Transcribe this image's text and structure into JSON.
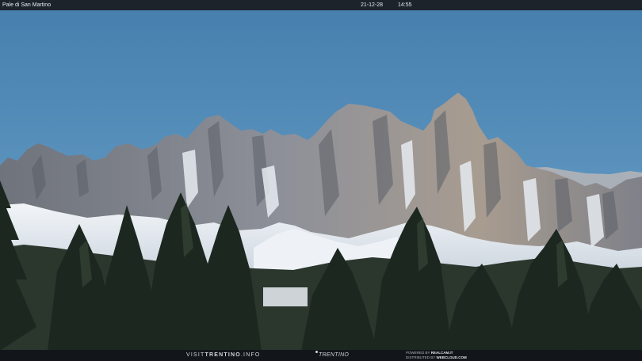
{
  "header": {
    "location": "Pale di San Martino",
    "date": "21-12-28",
    "time": "14:55"
  },
  "footer": {
    "brand_prefix": "VISIT",
    "brand_strong": "TRENTINO",
    "brand_suffix": ".INFO",
    "logo_text": "TRENTINO",
    "powered_line1_prefix": "POWERED BY",
    "powered_line1_name": "REALCAM.IT",
    "powered_line2_prefix": "DISTRIBUTED BY",
    "powered_line2_name": "WEBCLOUD.COM"
  },
  "colors": {
    "sky_top": "#4a84b2",
    "sky_bottom": "#6da1c8",
    "rock": "#8a8e95",
    "snow": "#e9edf2",
    "forest": "#1f2b22"
  }
}
